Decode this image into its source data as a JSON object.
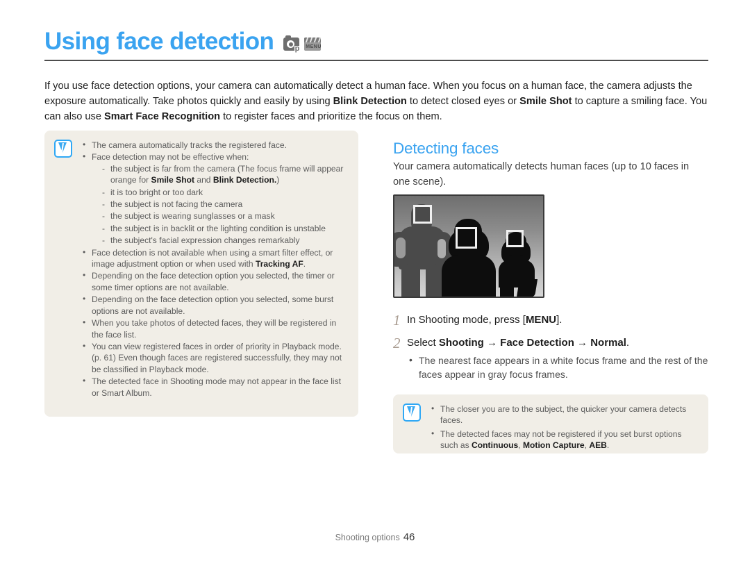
{
  "header": {
    "title": "Using face detection",
    "mode_icons": [
      {
        "name": "photo-mode-icon",
        "label": "p"
      },
      {
        "name": "movie-mode-icon",
        "label": "MENU"
      }
    ]
  },
  "intro": {
    "part1": "If you use face detection options, your camera can automatically detect a human face. When you focus on a human face, the camera adjusts the exposure automatically. Take photos quickly and easily by using ",
    "bold1": "Blink Detection",
    "part2": " to detect closed eyes or ",
    "bold2": "Smile Shot",
    "part3": " to capture a smiling face. You can also use ",
    "bold3": "Smart Face Recognition",
    "part4": " to register faces and prioritize the focus on them."
  },
  "note_left": {
    "icon": "note-pen-icon",
    "items": [
      {
        "text": "The camera automatically tracks the registered face."
      },
      {
        "text": "Face detection may not be effective when:",
        "sub": [
          {
            "pre": "the subject is far from the camera (The focus frame will appear orange for ",
            "b1": "Smile Shot",
            "mid": " and ",
            "b2": "Blink Detection.",
            "post": ")"
          },
          {
            "pre": "it is too bright or too dark"
          },
          {
            "pre": "the subject is not facing the camera"
          },
          {
            "pre": "the subject is wearing sunglasses or a mask"
          },
          {
            "pre": "the subject is in backlit or the lighting condition is unstable"
          },
          {
            "pre": "the subject's facial expression changes remarkably"
          }
        ]
      },
      {
        "pre": "Face detection is not available when using a smart filter effect, or image adjustment option or when used with ",
        "b1": "Tracking AF",
        "post": "."
      },
      {
        "text": "Depending on the face detection option you selected, the timer or some timer options are not available."
      },
      {
        "text": "Depending on the face detection option you selected, some burst options are not available."
      },
      {
        "text": "When you take photos of detected faces, they will be registered in the face list."
      },
      {
        "text": "You can view registered faces in order of priority in Playback mode. (p. 61) Even though faces are registered successfully, they may  not be classified in Playback mode."
      },
      {
        "text": "The detected face in Shooting mode may not appear in the face list or Smart Album."
      }
    ]
  },
  "section": {
    "title": "Detecting faces",
    "description": "Your camera automatically detects human faces (up to 10 faces in one scene)."
  },
  "illustration": {
    "name": "face-detection-illustration",
    "alt": "Three people with face detection frames",
    "face_frames": 3
  },
  "steps": [
    {
      "number": "1",
      "pre": "In Shooting mode, press [",
      "bold": "MENU",
      "post": "]."
    },
    {
      "number": "2",
      "pre": "Select ",
      "bold": "Shooting → Face Detection → Normal",
      "post": ".",
      "sub": [
        "The nearest face appears in a white focus frame and the rest of the faces appear in gray focus frames."
      ]
    }
  ],
  "note_right": {
    "icon": "note-pen-icon",
    "items": [
      {
        "text": "The closer you are to the subject, the quicker your camera detects faces."
      },
      {
        "pre": "The detected faces may not be registered if you set burst options such as ",
        "b1": "Continuous",
        "sep1": ", ",
        "b2": "Motion Capture",
        "sep2": ", ",
        "b3": "AEB",
        "post": "."
      }
    ]
  },
  "footer": {
    "label": "Shooting options",
    "page": "46"
  },
  "colors": {
    "accent": "#3aa3f0",
    "note_bg": "#f1eee7",
    "note_text": "#5c5c5c",
    "step_number": "#a89b90"
  }
}
